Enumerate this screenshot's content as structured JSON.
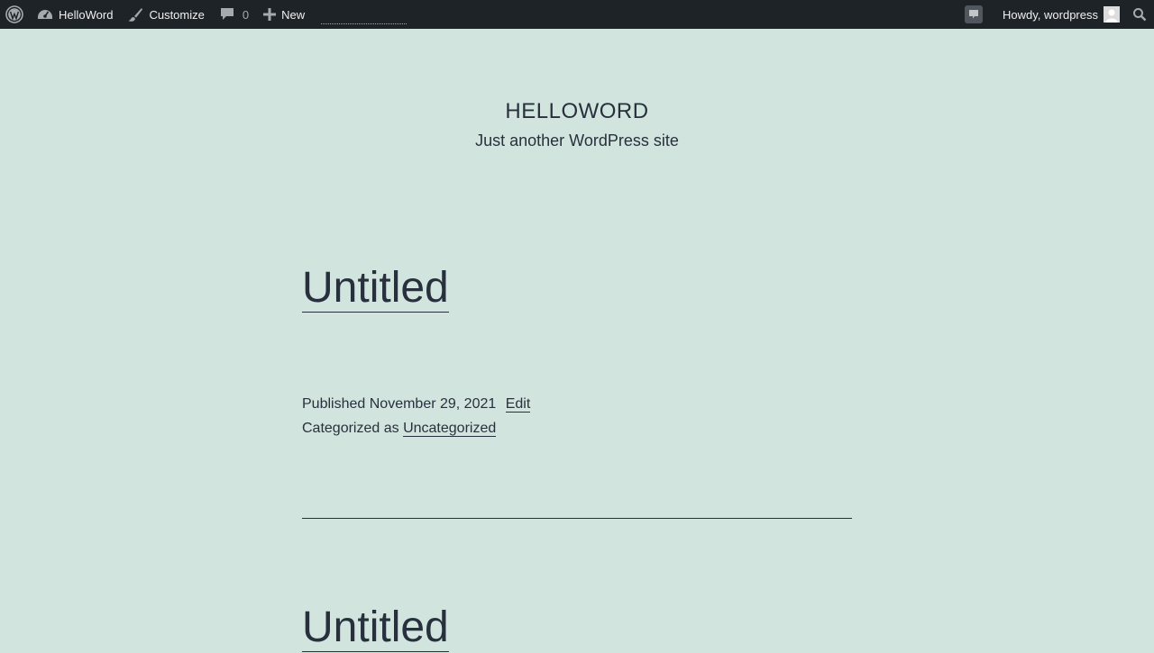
{
  "adminbar": {
    "site_name": "HelloWord",
    "customize": "Customize",
    "comments_count": "0",
    "new": "New",
    "howdy": "Howdy, wordpress"
  },
  "site": {
    "title": "HELLOWORD",
    "description": "Just another WordPress site"
  },
  "posts": [
    {
      "title": "Untitled",
      "published_label": "Published",
      "date": "November 29, 2021",
      "edit": "Edit",
      "categorized_label": "Categorized as",
      "category": "Uncategorized"
    },
    {
      "title": "Untitled"
    }
  ],
  "colors": {
    "background": "#d1e4dd",
    "adminbar": "#1d2327",
    "text": "#28303d"
  }
}
